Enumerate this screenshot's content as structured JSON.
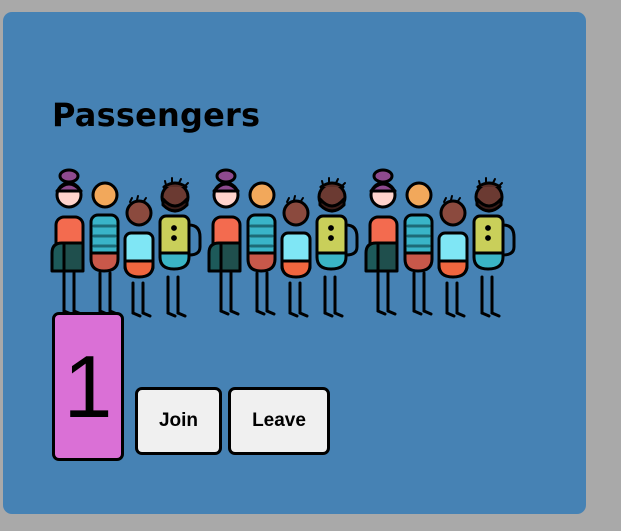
{
  "panel": {
    "title": "Passengers",
    "background": "#4682b4"
  },
  "counter": {
    "value": "1",
    "background": "#da70d6"
  },
  "buttons": {
    "join_label": "Join",
    "leave_label": "Leave",
    "background": "#f0f0f0"
  },
  "illustration": {
    "icon": "people-crowd-icon",
    "group_count": 3
  }
}
